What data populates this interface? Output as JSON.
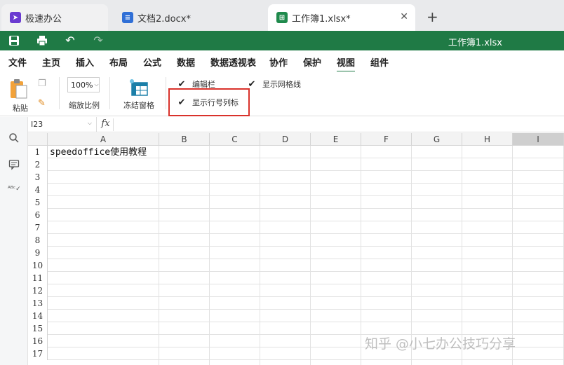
{
  "tabs": [
    {
      "label": "极速办公",
      "icon": "rocket-icon"
    },
    {
      "label": "文档2.docx*",
      "icon": "doc-icon"
    },
    {
      "label": "工作簿1.xlsx*",
      "icon": "sheet-icon",
      "close": "✕"
    }
  ],
  "new_tab": "+",
  "title_bar": {
    "doc_title": "工作簿1.xlsx",
    "color": "#1f7a45"
  },
  "menu": [
    "文件",
    "主页",
    "插入",
    "布局",
    "公式",
    "数据",
    "数据透视表",
    "协作",
    "保护",
    "视图",
    "组件"
  ],
  "ribbon": {
    "paste": "粘贴",
    "zoom_value": "100%",
    "zoom_label": "缩放比例",
    "freeze_label": "冻结窗格",
    "checkboxes": [
      {
        "label": "编辑栏",
        "checked": true
      },
      {
        "label": "显示网格线",
        "checked": true
      },
      {
        "label": "显示行号列标",
        "checked": true
      }
    ]
  },
  "formula_bar": {
    "name_box": "I23",
    "fx": "fx",
    "value": ""
  },
  "grid": {
    "columns": [
      "A",
      "B",
      "C",
      "D",
      "E",
      "F",
      "G",
      "H",
      "I"
    ],
    "selected_column": "I",
    "rows": [
      "1",
      "2",
      "3",
      "4",
      "5",
      "6",
      "7",
      "8",
      "9",
      "10",
      "11",
      "12",
      "13",
      "14",
      "15",
      "16",
      "17"
    ],
    "a1": "speedoffice使用教程"
  },
  "watermark": "知乎 @小七办公技巧分享"
}
